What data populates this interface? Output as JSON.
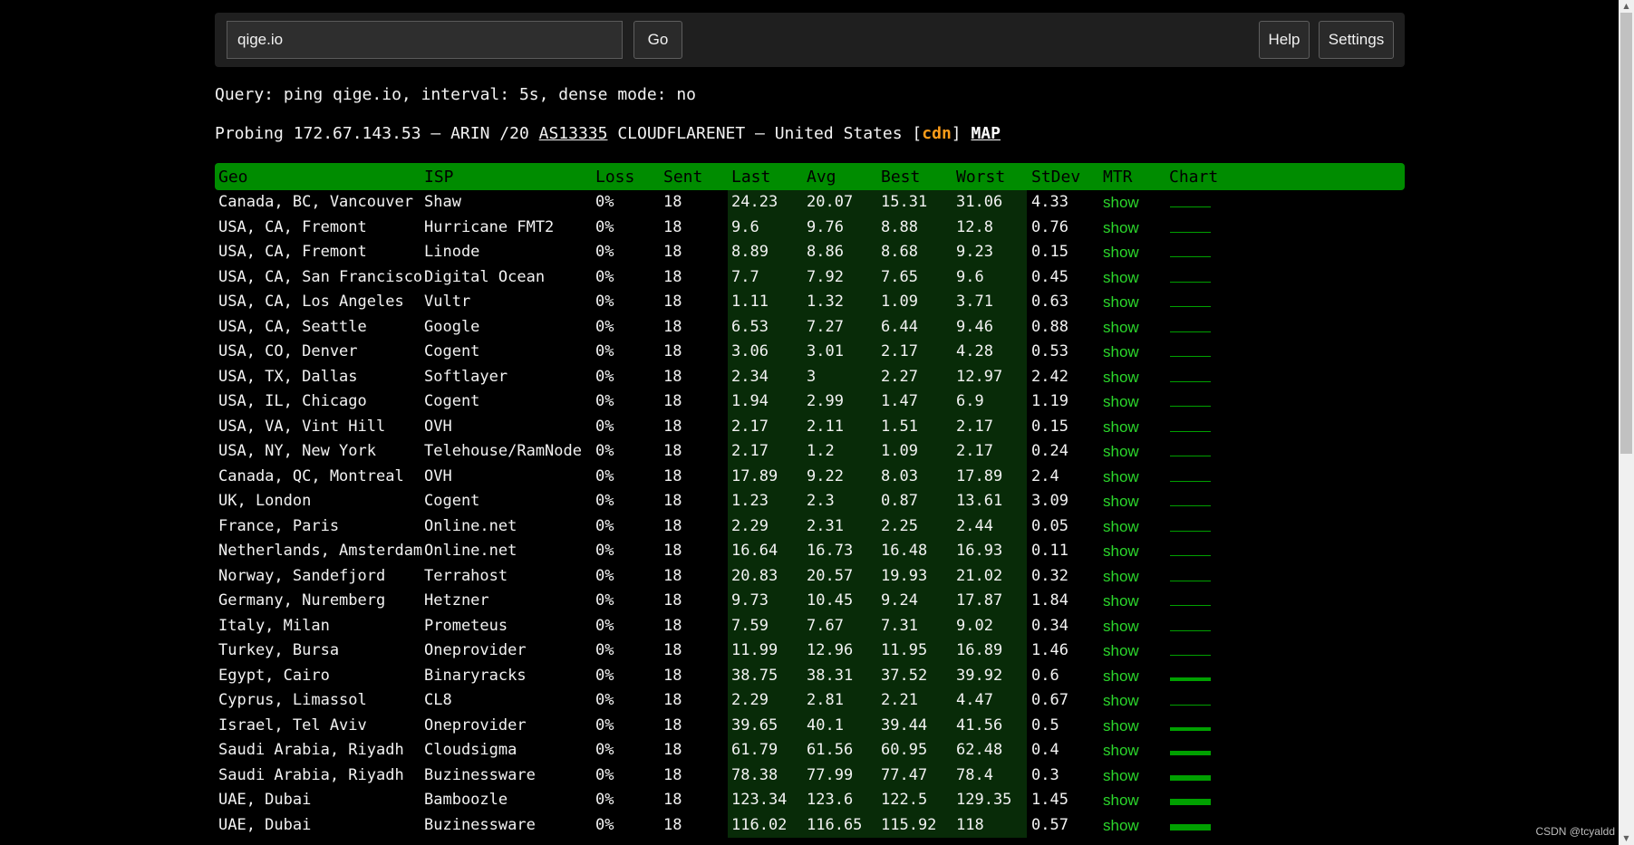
{
  "search": {
    "value": "qige.io"
  },
  "buttons": {
    "go": "Go",
    "help": "Help",
    "settings": "Settings"
  },
  "query_line": "Query: ping qige.io, interval: 5s, dense mode: no",
  "probe": {
    "prefix": "Probing 172.67.143.53 — ARIN /20 ",
    "asn": "AS13335",
    "org": " CLOUDFLARENET — United States [",
    "cdn": "cdn",
    "close": "] ",
    "map": "MAP"
  },
  "colors": {
    "header_green": "#008c00",
    "stats_band": "#082b08",
    "mtr_link": "#2bd62b",
    "cdn_orange": "#ff9d1a"
  },
  "table": {
    "headers": [
      "Geo",
      "ISP",
      "Loss",
      "Sent",
      "Last",
      "Avg",
      "Best",
      "Worst",
      "StDev",
      "MTR",
      "Chart"
    ],
    "rows": [
      {
        "geo": "Canada, BC, Vancouver",
        "isp": "Shaw",
        "loss": "0%",
        "sent": "18",
        "last": "24.23",
        "avg": "20.07",
        "best": "15.31",
        "worst": "31.06",
        "stdev": "4.33",
        "mtr": "show",
        "chart_level": 0.2
      },
      {
        "geo": "USA, CA, Fremont",
        "isp": "Hurricane FMT2",
        "loss": "0%",
        "sent": "18",
        "last": "9.6",
        "avg": "9.76",
        "best": "8.88",
        "worst": "12.8",
        "stdev": "0.76",
        "mtr": "show",
        "chart_level": 0.12
      },
      {
        "geo": "USA, CA, Fremont",
        "isp": "Linode",
        "loss": "0%",
        "sent": "18",
        "last": "8.89",
        "avg": "8.86",
        "best": "8.68",
        "worst": "9.23",
        "stdev": "0.15",
        "mtr": "show",
        "chart_level": 0.1
      },
      {
        "geo": "USA, CA, San Francisco",
        "isp": "Digital Ocean",
        "loss": "0%",
        "sent": "18",
        "last": "7.7",
        "avg": "7.92",
        "best": "7.65",
        "worst": "9.6",
        "stdev": "0.45",
        "mtr": "show",
        "chart_level": 0.1
      },
      {
        "geo": "USA, CA, Los Angeles",
        "isp": "Vultr",
        "loss": "0%",
        "sent": "18",
        "last": "1.11",
        "avg": "1.32",
        "best": "1.09",
        "worst": "3.71",
        "stdev": "0.63",
        "mtr": "show",
        "chart_level": 0.05
      },
      {
        "geo": "USA, CA, Seattle",
        "isp": "Google",
        "loss": "0%",
        "sent": "18",
        "last": "6.53",
        "avg": "7.27",
        "best": "6.44",
        "worst": "9.46",
        "stdev": "0.88",
        "mtr": "show",
        "chart_level": 0.1
      },
      {
        "geo": "USA, CO, Denver",
        "isp": "Cogent",
        "loss": "0%",
        "sent": "18",
        "last": "3.06",
        "avg": "3.01",
        "best": "2.17",
        "worst": "4.28",
        "stdev": "0.53",
        "mtr": "show",
        "chart_level": 0.05
      },
      {
        "geo": "USA, TX, Dallas",
        "isp": "Softlayer",
        "loss": "0%",
        "sent": "18",
        "last": "2.34",
        "avg": "3",
        "best": "2.27",
        "worst": "12.97",
        "stdev": "2.42",
        "mtr": "show",
        "chart_level": 0.05
      },
      {
        "geo": "USA, IL, Chicago",
        "isp": "Cogent",
        "loss": "0%",
        "sent": "18",
        "last": "1.94",
        "avg": "2.99",
        "best": "1.47",
        "worst": "6.9",
        "stdev": "1.19",
        "mtr": "show",
        "chart_level": 0.05
      },
      {
        "geo": "USA, VA, Vint Hill",
        "isp": "OVH",
        "loss": "0%",
        "sent": "18",
        "last": "2.17",
        "avg": "2.11",
        "best": "1.51",
        "worst": "2.17",
        "stdev": "0.15",
        "mtr": "show",
        "chart_level": 0.05
      },
      {
        "geo": "USA, NY, New York",
        "isp": "Telehouse/RamNode",
        "loss": "0%",
        "sent": "18",
        "last": "2.17",
        "avg": "1.2",
        "best": "1.09",
        "worst": "2.17",
        "stdev": "0.24",
        "mtr": "show",
        "chart_level": 0.05
      },
      {
        "geo": "Canada, QC, Montreal",
        "isp": "OVH",
        "loss": "0%",
        "sent": "18",
        "last": "17.89",
        "avg": "9.22",
        "best": "8.03",
        "worst": "17.89",
        "stdev": "2.4",
        "mtr": "show",
        "chart_level": 0.12
      },
      {
        "geo": "UK, London",
        "isp": "Cogent",
        "loss": "0%",
        "sent": "18",
        "last": "1.23",
        "avg": "2.3",
        "best": "0.87",
        "worst": "13.61",
        "stdev": "3.09",
        "mtr": "show",
        "chart_level": 0.05
      },
      {
        "geo": "France, Paris",
        "isp": "Online.net",
        "loss": "0%",
        "sent": "18",
        "last": "2.29",
        "avg": "2.31",
        "best": "2.25",
        "worst": "2.44",
        "stdev": "0.05",
        "mtr": "show",
        "chart_level": 0.05
      },
      {
        "geo": "Netherlands, Amsterdam",
        "isp": "Online.net",
        "loss": "0%",
        "sent": "18",
        "last": "16.64",
        "avg": "16.73",
        "best": "16.48",
        "worst": "16.93",
        "stdev": "0.11",
        "mtr": "show",
        "chart_level": 0.2
      },
      {
        "geo": "Norway, Sandefjord",
        "isp": "Terrahost",
        "loss": "0%",
        "sent": "18",
        "last": "20.83",
        "avg": "20.57",
        "best": "19.93",
        "worst": "21.02",
        "stdev": "0.32",
        "mtr": "show",
        "chart_level": 0.2
      },
      {
        "geo": "Germany, Nuremberg",
        "isp": "Hetzner",
        "loss": "0%",
        "sent": "18",
        "last": "9.73",
        "avg": "10.45",
        "best": "9.24",
        "worst": "17.87",
        "stdev": "1.84",
        "mtr": "show",
        "chart_level": 0.12
      },
      {
        "geo": "Italy, Milan",
        "isp": "Prometeus",
        "loss": "0%",
        "sent": "18",
        "last": "7.59",
        "avg": "7.67",
        "best": "7.31",
        "worst": "9.02",
        "stdev": "0.34",
        "mtr": "show",
        "chart_level": 0.1
      },
      {
        "geo": "Turkey, Bursa",
        "isp": "Oneprovider",
        "loss": "0%",
        "sent": "18",
        "last": "11.99",
        "avg": "12.96",
        "best": "11.95",
        "worst": "16.89",
        "stdev": "1.46",
        "mtr": "show",
        "chart_level": 0.12
      },
      {
        "geo": "Egypt, Cairo",
        "isp": "Binaryracks",
        "loss": "0%",
        "sent": "18",
        "last": "38.75",
        "avg": "38.31",
        "best": "37.52",
        "worst": "39.92",
        "stdev": "0.6",
        "mtr": "show",
        "chart_level": 0.55
      },
      {
        "geo": "Cyprus, Limassol",
        "isp": "CL8",
        "loss": "0%",
        "sent": "18",
        "last": "2.29",
        "avg": "2.81",
        "best": "2.21",
        "worst": "4.47",
        "stdev": "0.67",
        "mtr": "show",
        "chart_level": 0.05
      },
      {
        "geo": "Israel, Tel Aviv",
        "isp": "Oneprovider",
        "loss": "0%",
        "sent": "18",
        "last": "39.65",
        "avg": "40.1",
        "best": "39.44",
        "worst": "41.56",
        "stdev": "0.5",
        "mtr": "show",
        "chart_level": 0.55
      },
      {
        "geo": "Saudi Arabia, Riyadh",
        "isp": "Cloudsigma",
        "loss": "0%",
        "sent": "18",
        "last": "61.79",
        "avg": "61.56",
        "best": "60.95",
        "worst": "62.48",
        "stdev": "0.4",
        "mtr": "show",
        "chart_level": 0.65
      },
      {
        "geo": "Saudi Arabia, Riyadh",
        "isp": "Buzinessware",
        "loss": "0%",
        "sent": "18",
        "last": "78.38",
        "avg": "77.99",
        "best": "77.47",
        "worst": "78.4",
        "stdev": "0.3",
        "mtr": "show",
        "chart_level": 0.8
      },
      {
        "geo": "UAE, Dubai",
        "isp": "Bamboozle",
        "loss": "0%",
        "sent": "18",
        "last": "123.34",
        "avg": "123.6",
        "best": "122.5",
        "worst": "129.35",
        "stdev": "1.45",
        "mtr": "show",
        "chart_level": 1.0
      },
      {
        "geo": "UAE, Dubai",
        "isp": "Buzinessware",
        "loss": "0%",
        "sent": "18",
        "last": "116.02",
        "avg": "116.65",
        "best": "115.92",
        "worst": "118",
        "stdev": "0.57",
        "mtr": "show",
        "chart_level": 1.0
      }
    ]
  },
  "watermark": "CSDN @tcyaldd"
}
